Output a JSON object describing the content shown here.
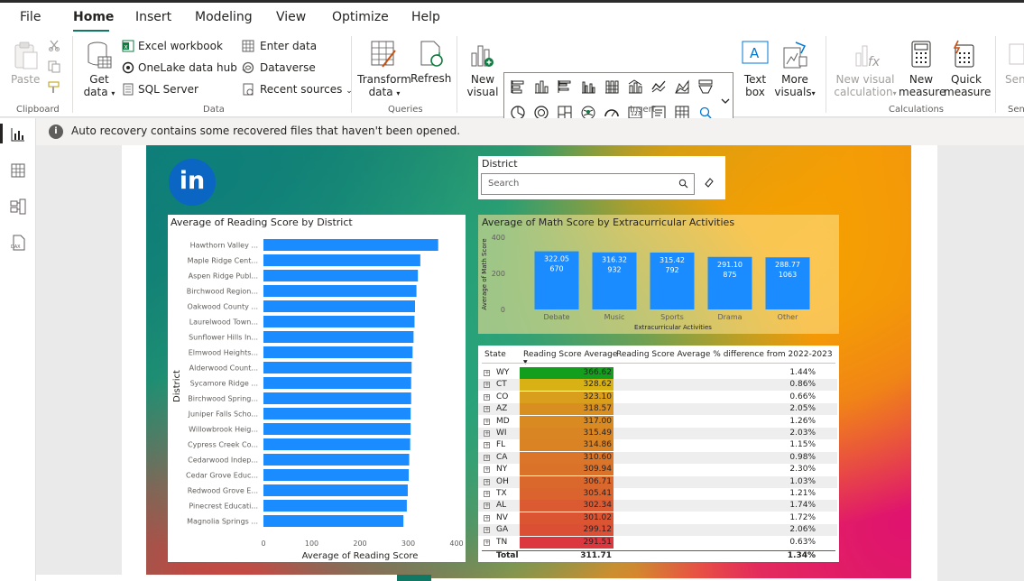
{
  "menu": {
    "items": [
      "File",
      "Home",
      "Insert",
      "Modeling",
      "View",
      "Optimize",
      "Help"
    ],
    "active": "Home"
  },
  "ribbon": {
    "clipboard": {
      "paste": "Paste",
      "group_label": "Clipboard"
    },
    "data": {
      "get_data": [
        "Get",
        "data"
      ],
      "excel": "Excel workbook",
      "onelake": "OneLake data hub",
      "sql": "SQL Server",
      "enter_data": "Enter data",
      "dataverse": "Dataverse",
      "recent": "Recent sources",
      "group_label": "Data"
    },
    "queries": {
      "transform": [
        "Transform",
        "data"
      ],
      "refresh": "Refresh",
      "group_label": "Queries"
    },
    "insert": {
      "new_visual": [
        "New",
        "visual"
      ],
      "text_box": [
        "Text",
        "box"
      ],
      "more_visuals": [
        "More",
        "visuals"
      ],
      "group_label": "Insert"
    },
    "calculations": {
      "new_visual_calc": [
        "New visual",
        "calculation"
      ],
      "new_measure": [
        "New",
        "measure"
      ],
      "quick_measure": [
        "Quick",
        "measure"
      ],
      "group_label": "Calculations"
    },
    "sensitivity": {
      "label": "Sens",
      "group_label": "Sen"
    }
  },
  "notification": {
    "text": "Auto recovery contains some recovered files that haven't been opened."
  },
  "logo": {
    "text": "in"
  },
  "slicer": {
    "title": "District",
    "placeholder": "Search"
  },
  "colors": {
    "bar_blue": "#1a8cff",
    "teal": "#117865",
    "linkedin": "#0a66c2"
  },
  "reading_chart": {
    "title": "Average of Reading Score by District",
    "xlabel": "Average of Reading Score",
    "ylabel": "District"
  },
  "math_chart": {
    "title": "Average of Math Score by Extracurricular Activities",
    "xlabel": "Extracurricular Activities",
    "ylabel": "Average of Math Score"
  },
  "state_table": {
    "headers": [
      "State",
      "Reading Score Average",
      "Reading Score Average % difference from 2022-2023"
    ],
    "rows": [
      {
        "state": "WY",
        "avg": "366.62",
        "diff": "1.44%"
      },
      {
        "state": "CT",
        "avg": "328.62",
        "diff": "0.86%"
      },
      {
        "state": "CO",
        "avg": "323.10",
        "diff": "0.66%"
      },
      {
        "state": "AZ",
        "avg": "318.57",
        "diff": "2.05%"
      },
      {
        "state": "MD",
        "avg": "317.00",
        "diff": "1.26%"
      },
      {
        "state": "WI",
        "avg": "315.49",
        "diff": "2.03%"
      },
      {
        "state": "FL",
        "avg": "314.86",
        "diff": "1.15%"
      },
      {
        "state": "CA",
        "avg": "310.60",
        "diff": "0.98%"
      },
      {
        "state": "NY",
        "avg": "309.94",
        "diff": "2.30%"
      },
      {
        "state": "OH",
        "avg": "306.71",
        "diff": "1.03%"
      },
      {
        "state": "TX",
        "avg": "305.41",
        "diff": "1.21%"
      },
      {
        "state": "AL",
        "avg": "302.34",
        "diff": "1.74%"
      },
      {
        "state": "NV",
        "avg": "301.02",
        "diff": "1.72%"
      },
      {
        "state": "GA",
        "avg": "299.12",
        "diff": "2.06%"
      },
      {
        "state": "TN",
        "avg": "291.51",
        "diff": "0.63%"
      }
    ],
    "total": {
      "label": "Total",
      "avg": "311.71",
      "diff": "1.34%"
    }
  },
  "chart_data": [
    {
      "type": "bar",
      "orientation": "horizontal",
      "title": "Average of Reading Score by District",
      "xlabel": "Average of Reading Score",
      "ylabel": "District",
      "xlim": [
        0,
        400
      ],
      "xticks": [
        0,
        100,
        200,
        300,
        400
      ],
      "categories": [
        "Hawthorn Valley ...",
        "Maple Ridge Cent...",
        "Aspen Ridge Publ...",
        "Birchwood Region...",
        "Oakwood County ...",
        "Laurelwood Town...",
        "Sunflower Hills In...",
        "Elmwood Heights...",
        "Alderwood Count...",
        "Sycamore Ridge ...",
        "Birchwood Spring...",
        "Juniper Falls Scho...",
        "Willowbrook Heig...",
        "Cypress Creek Co...",
        "Cedarwood Indep...",
        "Cedar Grove Educ...",
        "Redwood Grove E...",
        "Pinecrest Educati...",
        "Magnolia Springs ..."
      ],
      "values": [
        362,
        325,
        320,
        317,
        314,
        313,
        311,
        309,
        307,
        306,
        306,
        305,
        305,
        304,
        302,
        301,
        299,
        297,
        290
      ],
      "color": "#1a8cff",
      "grid": false
    },
    {
      "type": "bar",
      "orientation": "vertical",
      "title": "Average of Math Score by Extracurricular Activities",
      "xlabel": "Extracurricular Activities",
      "ylabel": "Average of Math Score",
      "ylim": [
        0,
        400
      ],
      "yticks": [
        0,
        200,
        400
      ],
      "categories": [
        "Debate",
        "Music",
        "Sports",
        "Drama",
        "Other"
      ],
      "values": [
        322.05,
        316.32,
        315.42,
        291.1,
        288.77
      ],
      "value_labels": [
        "322.05",
        "316.32",
        "315.42",
        "291.10",
        "288.77"
      ],
      "count_labels": [
        "670",
        "932",
        "792",
        "875",
        "1063"
      ],
      "color": "#1a8cff"
    }
  ]
}
